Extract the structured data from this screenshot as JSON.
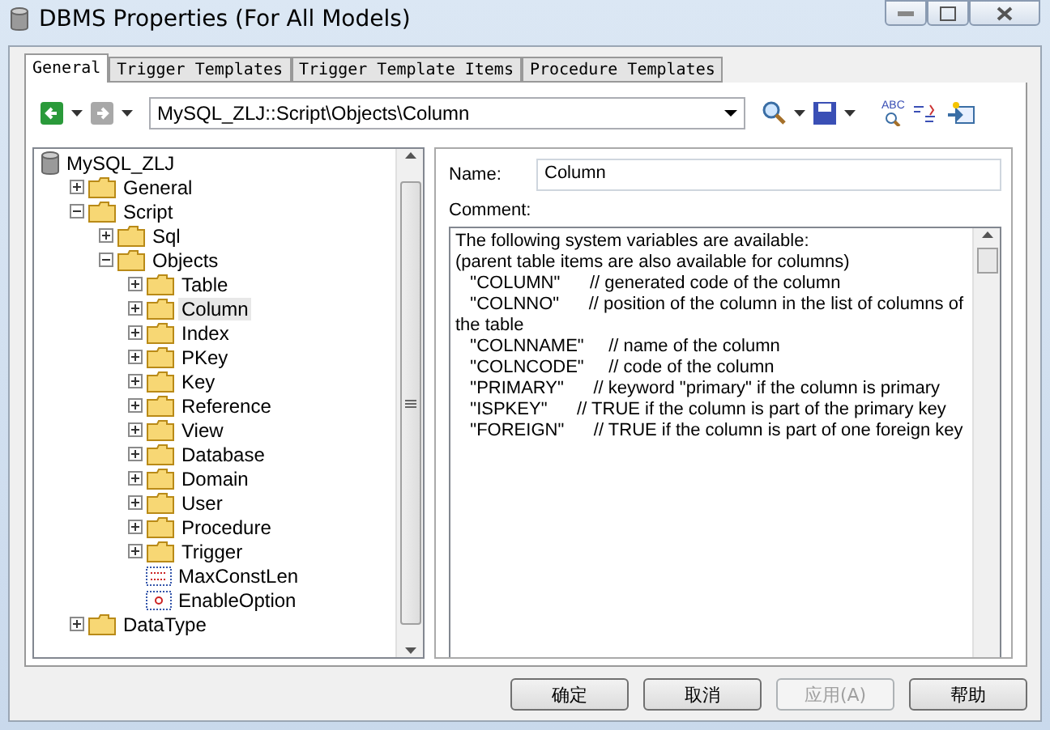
{
  "window": {
    "title": "DBMS Properties (For All Models)"
  },
  "tabs": [
    {
      "label": "General",
      "selected": true
    },
    {
      "label": "Trigger Templates",
      "selected": false
    },
    {
      "label": "Trigger Template Items",
      "selected": false
    },
    {
      "label": "Procedure Templates",
      "selected": false
    }
  ],
  "toolbar": {
    "path": "MySQL_ZLJ::Script\\Objects\\Column",
    "spell_check_label": "ABC"
  },
  "tree": {
    "root": {
      "label": "MySQL_ZLJ",
      "kind": "root",
      "selected": false,
      "children": [
        {
          "label": "General",
          "kind": "folder",
          "expanded": false,
          "selected": false
        },
        {
          "label": "Script",
          "kind": "folder",
          "expanded": true,
          "selected": false,
          "children": [
            {
              "label": "Sql",
              "kind": "folder",
              "expanded": false,
              "selected": false
            },
            {
              "label": "Objects",
              "kind": "folder",
              "expanded": true,
              "selected": false,
              "children": [
                {
                  "label": "Table",
                  "kind": "folder",
                  "expanded": false,
                  "selected": false
                },
                {
                  "label": "Column",
                  "kind": "folder",
                  "expanded": false,
                  "selected": true
                },
                {
                  "label": "Index",
                  "kind": "folder",
                  "expanded": false,
                  "selected": false
                },
                {
                  "label": "PKey",
                  "kind": "folder",
                  "expanded": false,
                  "selected": false
                },
                {
                  "label": "Key",
                  "kind": "folder",
                  "expanded": false,
                  "selected": false
                },
                {
                  "label": "Reference",
                  "kind": "folder",
                  "expanded": false,
                  "selected": false
                },
                {
                  "label": "View",
                  "kind": "folder",
                  "expanded": false,
                  "selected": false
                },
                {
                  "label": "Database",
                  "kind": "folder",
                  "expanded": false,
                  "selected": false
                },
                {
                  "label": "Domain",
                  "kind": "folder",
                  "expanded": false,
                  "selected": false
                },
                {
                  "label": "User",
                  "kind": "folder",
                  "expanded": false,
                  "selected": false
                },
                {
                  "label": "Procedure",
                  "kind": "folder",
                  "expanded": false,
                  "selected": false
                },
                {
                  "label": "Trigger",
                  "kind": "folder",
                  "expanded": false,
                  "selected": false
                },
                {
                  "label": "MaxConstLen",
                  "kind": "text_value",
                  "selected": false
                },
                {
                  "label": "EnableOption",
                  "kind": "bool_value",
                  "selected": false
                }
              ]
            }
          ]
        },
        {
          "label": "DataType",
          "kind": "folder",
          "expanded": false,
          "selected": false
        }
      ]
    }
  },
  "details": {
    "name_label": "Name:",
    "name_value": "Column",
    "comment_label": "Comment:",
    "comment_lines": [
      "The following system variables are available:",
      "(parent table items are also available for columns)",
      "   \"COLUMN\"      // generated code of the column",
      "   \"COLNNO\"      // position of the column in the list of columns of the table",
      "   \"COLNNAME\"     // name of the column",
      "   \"COLNCODE\"     // code of the column",
      "   \"PRIMARY\"      // keyword \"primary\" if the column is primary",
      "   \"ISPKEY\"      // TRUE if the column is part of the primary key",
      "   \"FOREIGN\"      // TRUE if the column is part of one foreign key"
    ]
  },
  "buttons": [
    {
      "label": "确定",
      "disabled": false
    },
    {
      "label": "取消",
      "disabled": false
    },
    {
      "label": "应用(A)",
      "disabled": true
    },
    {
      "label": "帮助",
      "disabled": false
    }
  ]
}
